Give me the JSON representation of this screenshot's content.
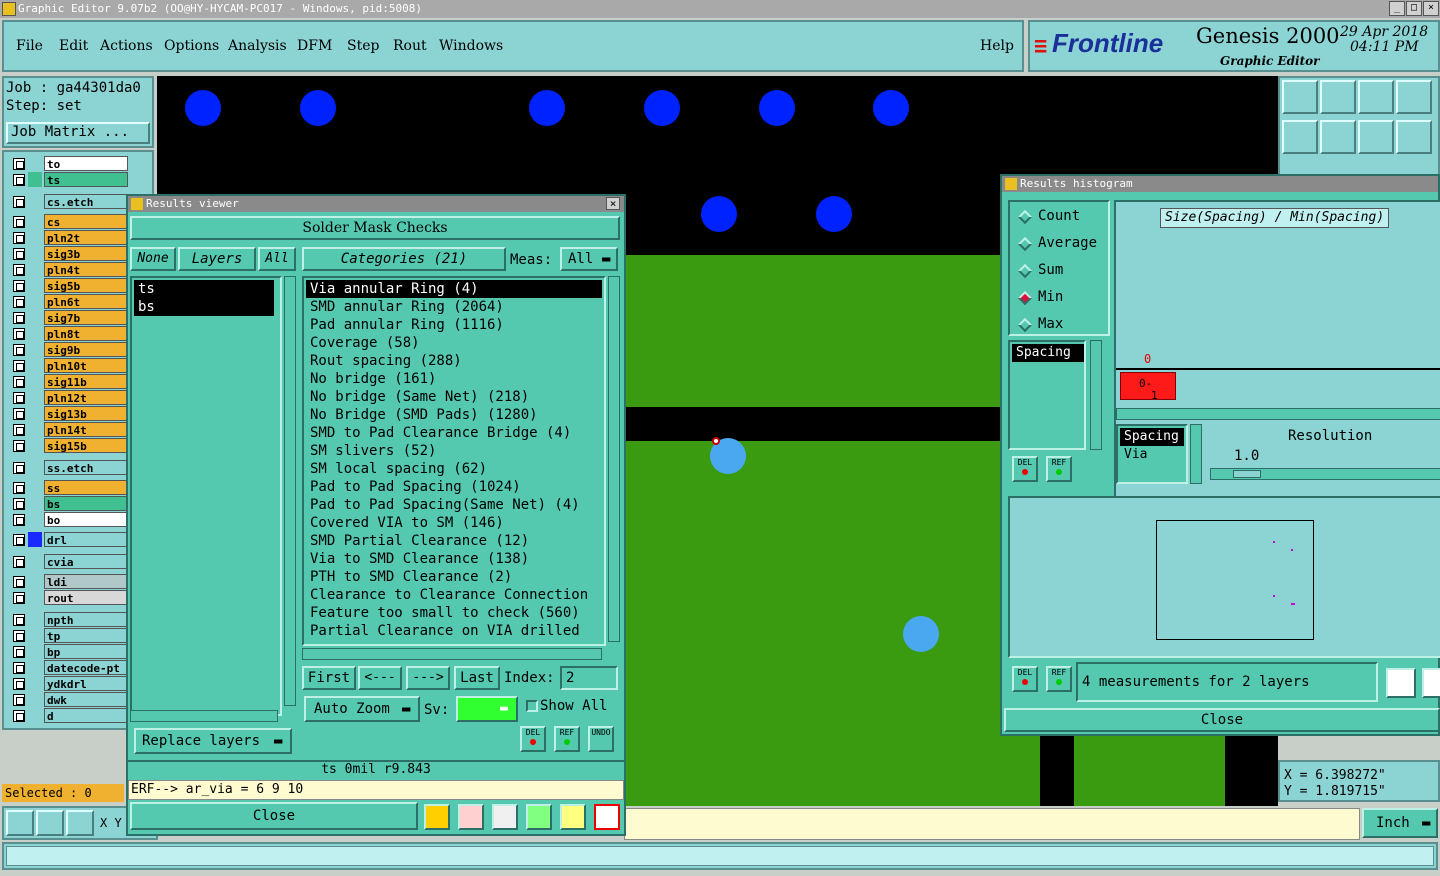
{
  "app": {
    "title": "Graphic Editor 9.07b2 (OO@HY-HYCAM-PC017 - Windows, pid:5008)",
    "brand": "Frontline",
    "product": "Genesis 2000",
    "subtitle": "Graphic Editor",
    "date": "29 Apr 2018",
    "time": "04:11 PM"
  },
  "menu": [
    "File",
    "Edit",
    "Actions",
    "Options",
    "Analysis",
    "DFM",
    "Step",
    "Rout",
    "Windows"
  ],
  "help": "Help",
  "job": {
    "job_label": "Job : ga44301da0",
    "step_label": "Step: set",
    "matrix_button": "Job Matrix ..."
  },
  "layers": [
    {
      "name": "to",
      "color": "#ffffff"
    },
    {
      "name": "ts",
      "color": "#40c090"
    },
    {
      "name": "cs.etch",
      "color": "#8cd3d3"
    },
    {
      "name": "cs",
      "color": "#f0b030"
    },
    {
      "name": "pln2t",
      "color": "#f0b030"
    },
    {
      "name": "sig3b",
      "color": "#f0b030"
    },
    {
      "name": "pln4t",
      "color": "#f0b030"
    },
    {
      "name": "sig5b",
      "color": "#f0b030"
    },
    {
      "name": "pln6t",
      "color": "#f0b030"
    },
    {
      "name": "sig7b",
      "color": "#f0b030"
    },
    {
      "name": "pln8t",
      "color": "#f0b030"
    },
    {
      "name": "sig9b",
      "color": "#f0b030"
    },
    {
      "name": "pln10t",
      "color": "#f0b030"
    },
    {
      "name": "sig11b",
      "color": "#f0b030"
    },
    {
      "name": "pln12t",
      "color": "#f0b030"
    },
    {
      "name": "sig13b",
      "color": "#f0b030"
    },
    {
      "name": "pln14t",
      "color": "#f0b030"
    },
    {
      "name": "sig15b",
      "color": "#f0b030"
    },
    {
      "name": "ss.etch",
      "color": "#8cd3d3"
    },
    {
      "name": "ss",
      "color": "#f0b030"
    },
    {
      "name": "bs",
      "color": "#40c090"
    },
    {
      "name": "bo",
      "color": "#ffffff"
    },
    {
      "name": "drl",
      "color": "#8cd3d3"
    },
    {
      "name": "cvia",
      "color": "#8cd3d3"
    },
    {
      "name": "ldi",
      "color": "#b0c8c8"
    },
    {
      "name": "rout",
      "color": "#d8d8d8"
    },
    {
      "name": "npth",
      "color": "#8cd3d3"
    },
    {
      "name": "tp",
      "color": "#8cd3d3"
    },
    {
      "name": "bp",
      "color": "#8cd3d3"
    },
    {
      "name": "datecode-pt",
      "color": "#8cd3d3"
    },
    {
      "name": "ydkdrl",
      "color": "#8cd3d3"
    },
    {
      "name": "dwk",
      "color": "#8cd3d3"
    },
    {
      "name": "d",
      "color": "#8cd3d3"
    }
  ],
  "selected": "Selected : 0",
  "xy_label": "X Y",
  "results_viewer": {
    "title": "Results viewer",
    "header": "Solder Mask Checks",
    "none_btn": "None",
    "layers_label": "Layers",
    "all_btn": "All",
    "categories_label": "Categories (21)",
    "meas_label": "Meas:",
    "meas_value": "All",
    "layer_items": [
      "ts",
      "bs"
    ],
    "categories": [
      "Via annular Ring (4)",
      "SMD annular Ring (2064)",
      "Pad annular Ring (1116)",
      "Coverage (58)",
      "Rout spacing (288)",
      "No bridge (161)",
      "No bridge (Same Net) (218)",
      "No Bridge (SMD Pads) (1280)",
      "SMD to Pad Clearance Bridge (4)",
      "SM slivers (52)",
      "SM local spacing (62)",
      "Pad to Pad Spacing (1024)",
      "Pad to Pad Spacing(Same Net) (4)",
      "Covered VIA to SM (146)",
      "SMD Partial Clearance (12)",
      "Via to SMD Clearance (138)",
      "PTH to SMD Clearance (2)",
      "Clearance to Clearance Connection",
      "Feature too small to check (560)",
      "Partial Clearance on VIA drilled"
    ],
    "first": "First",
    "prev": "<---",
    "next": "--->",
    "last": "Last",
    "index_label": "Index:",
    "index_value": "2",
    "auto_zoom": "Auto Zoom",
    "sv_label": "Sv:",
    "show_all": "Show All",
    "replace_layers": "Replace layers",
    "del": "DEL",
    "ref": "REF",
    "undo": "UNDO",
    "status": "ts 0mil  r9.843",
    "erf": "ERF--> ar_via = 6 9 10",
    "close": "Close"
  },
  "histogram": {
    "title": "Results histogram",
    "options": [
      "Count",
      "Average",
      "Sum",
      "Min",
      "Max"
    ],
    "selected_option": "Min",
    "graph_title": "Size(Spacing) / Min(Spacing)",
    "list1": [
      "Spacing"
    ],
    "list2": [
      "Spacing",
      "Via"
    ],
    "bar_top_label": "0",
    "bar_label_a": "0-",
    "bar_label_b": "1",
    "resolution_label": "Resolution",
    "resolution_value": "1.0",
    "del": "DEL",
    "ref": "REF",
    "summary": "4 measurements for 2 layers",
    "close": "Close"
  },
  "coords": {
    "x": "X = 6.398272\"",
    "y": "Y = 1.819715\""
  },
  "units": "Inch"
}
